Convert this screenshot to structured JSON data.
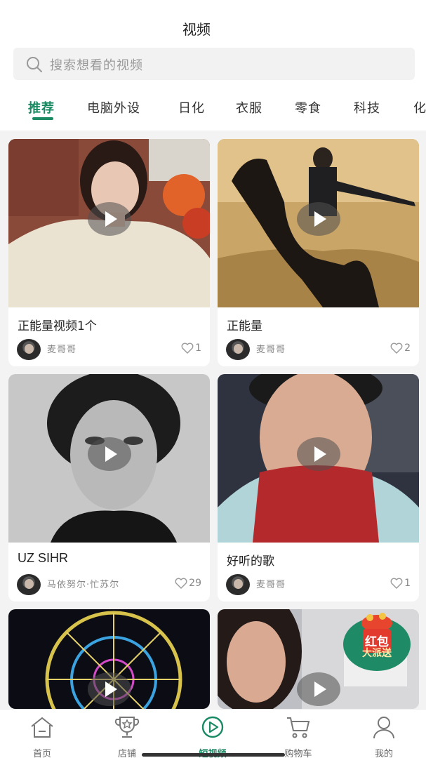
{
  "header": {
    "title": "视频",
    "search_placeholder": "搜索想看的视频"
  },
  "tabs": [
    {
      "label": "推荐",
      "active": true
    },
    {
      "label": "电脑外设",
      "active": false
    },
    {
      "label": "日化",
      "active": false
    },
    {
      "label": "衣服",
      "active": false
    },
    {
      "label": "零食",
      "active": false
    },
    {
      "label": "科技",
      "active": false
    },
    {
      "label": "化",
      "active": false
    }
  ],
  "videos": [
    {
      "title": "正能量视频1个",
      "author": "麦哥哥",
      "likes": "1"
    },
    {
      "title": "正能量",
      "author": "麦哥哥",
      "likes": "2"
    },
    {
      "title": "UZ SIHR",
      "author": "马依努尔·忙苏尔",
      "likes": "29"
    },
    {
      "title": "好听的歌",
      "author": "麦哥哥",
      "likes": "1"
    },
    {
      "title": "",
      "author": "",
      "likes": ""
    },
    {
      "title": "",
      "author": "",
      "likes": ""
    }
  ],
  "floating_badge": {
    "line1": "红包",
    "line2": "大派送"
  },
  "bottom_nav": [
    {
      "label": "首页",
      "icon": "home-icon",
      "active": false
    },
    {
      "label": "店铺",
      "icon": "store-trophy-icon",
      "active": false
    },
    {
      "label": "短视频",
      "icon": "play-circle-icon",
      "active": true
    },
    {
      "label": "购物车",
      "icon": "cart-icon",
      "active": false
    },
    {
      "label": "我的",
      "icon": "user-icon",
      "active": false
    }
  ],
  "colors": {
    "accent": "#1a8a63",
    "background": "#f3f3f3",
    "card": "#ffffff",
    "badge_red": "#e23b2e"
  }
}
